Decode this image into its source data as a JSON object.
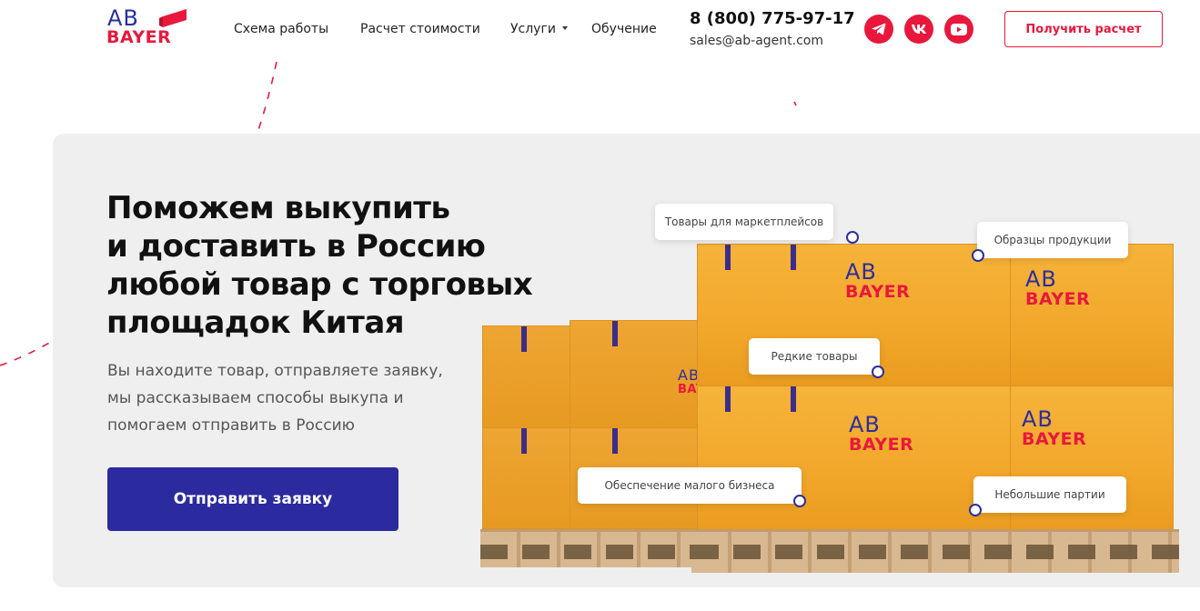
{
  "brand": {
    "logo_top": "AB",
    "logo_bottom": "BAYER",
    "colors": {
      "primary_red": "#e8183d",
      "primary_blue": "#2b2a9e",
      "hero_bg": "#efefef"
    }
  },
  "header": {
    "nav": [
      {
        "label": "Схема работы",
        "has_dropdown": false
      },
      {
        "label": "Расчет стоимости",
        "has_dropdown": false
      },
      {
        "label": "Услуги",
        "has_dropdown": true
      },
      {
        "label": "Обучение",
        "has_dropdown": false
      }
    ],
    "phone": "8 (800) 775-97-17",
    "email": "sales@ab-agent.com",
    "social": [
      {
        "icon": "telegram-icon"
      },
      {
        "icon": "vk-icon"
      },
      {
        "icon": "youtube-icon"
      }
    ],
    "cta_label": "Получить расчет"
  },
  "hero": {
    "title_lines": [
      "Поможем выкупить",
      "и доставить в Россию",
      "любой товар с торговых",
      "площадок Китая"
    ],
    "subtitle_lines": [
      "Вы находите товар, отправляете заявку,",
      "мы рассказываем способы выкупа и",
      "помогаем отправить в Россию"
    ],
    "button_label": "Отправить заявку"
  },
  "illustration": {
    "tags": [
      "Товары для маркетплейсов",
      "Образцы продукции",
      "Редкие товары",
      "Обеспечение малого бизнеса",
      "Небольшие партии"
    ]
  }
}
